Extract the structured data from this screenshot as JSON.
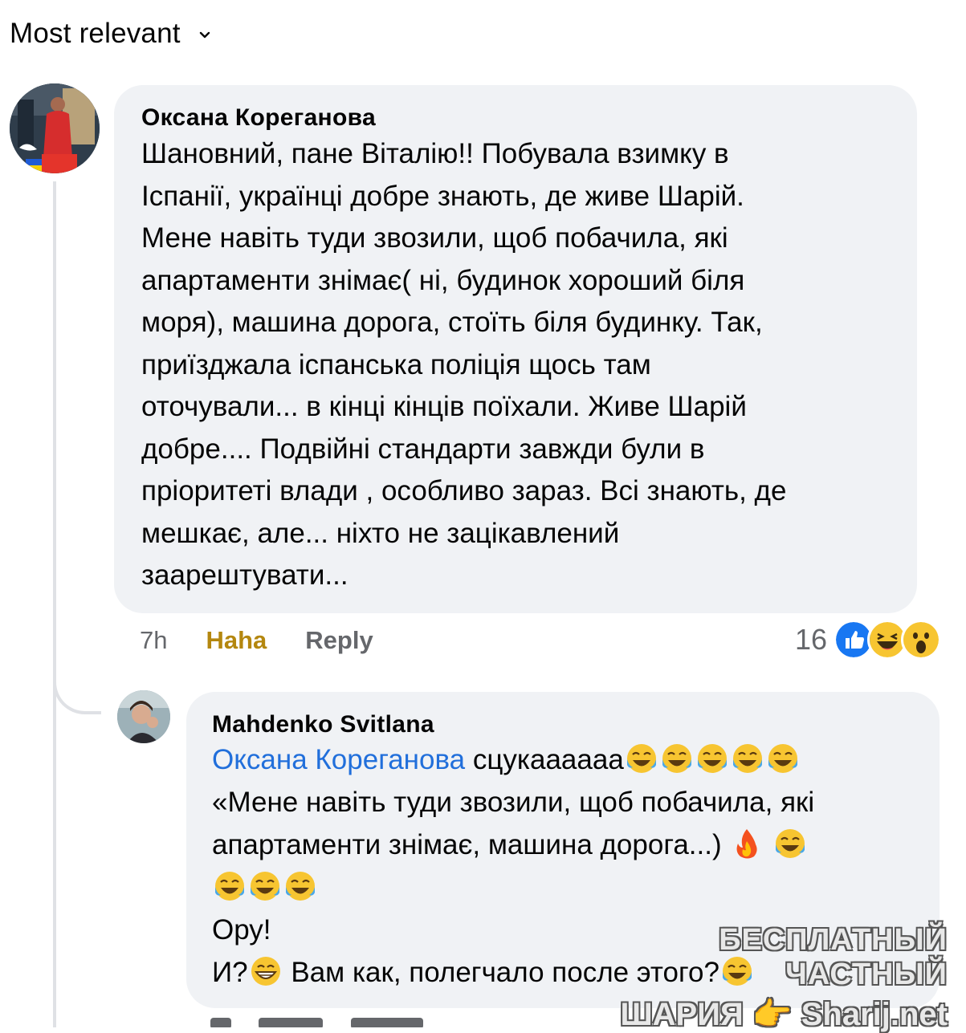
{
  "sort": {
    "label": "Most relevant",
    "icon": "chevron-down-icon"
  },
  "comment": {
    "author": "Оксана Кореганова",
    "lines": [
      "Шановний, пане Віталію!! Побувала взимку в",
      "Іспанії, українці добре знають, де живе Шарій.",
      "Мене навіть туди звозили, щоб побачила, які",
      "апартаменти знімає( ні, будинок хороший біля",
      "моря), машина дорога, стоїть біля будинку. Так,",
      "приїзджала іспанська поліція щось там",
      "оточували... в кінці кінців поїхали. Живе Шарій",
      "добре.... Подвійні стандарти завжди були в",
      "пріоритеті влади , особливо зараз. Всі знають, де",
      "мешкає, але... ніхто не зацікавлений",
      "заарештувати..."
    ],
    "time": "7h",
    "reaction_label": "Haha",
    "reply_label": "Reply",
    "reaction_count": "16",
    "reaction_icons": [
      "like-icon",
      "haha-icon",
      "wow-icon"
    ]
  },
  "reply": {
    "author": "Mahdenko Svitlana",
    "mention": "Оксана Кореганова",
    "line1_text": "сцукаааааа",
    "line2": "«Мене навіть туди звозили, щоб побачила, які",
    "line3": "апартаменти знімає, машина дорога...)",
    "line5": "Ору!",
    "line6_prefix": "И?",
    "line6_suffix": "Вам как, полегчало после этого?"
  },
  "watermark": {
    "line1": "БЕСПЛАТНЫЙ ЧАСТНЫЙ",
    "line2": "ШАРИЯ 👉 Sharij.net"
  }
}
